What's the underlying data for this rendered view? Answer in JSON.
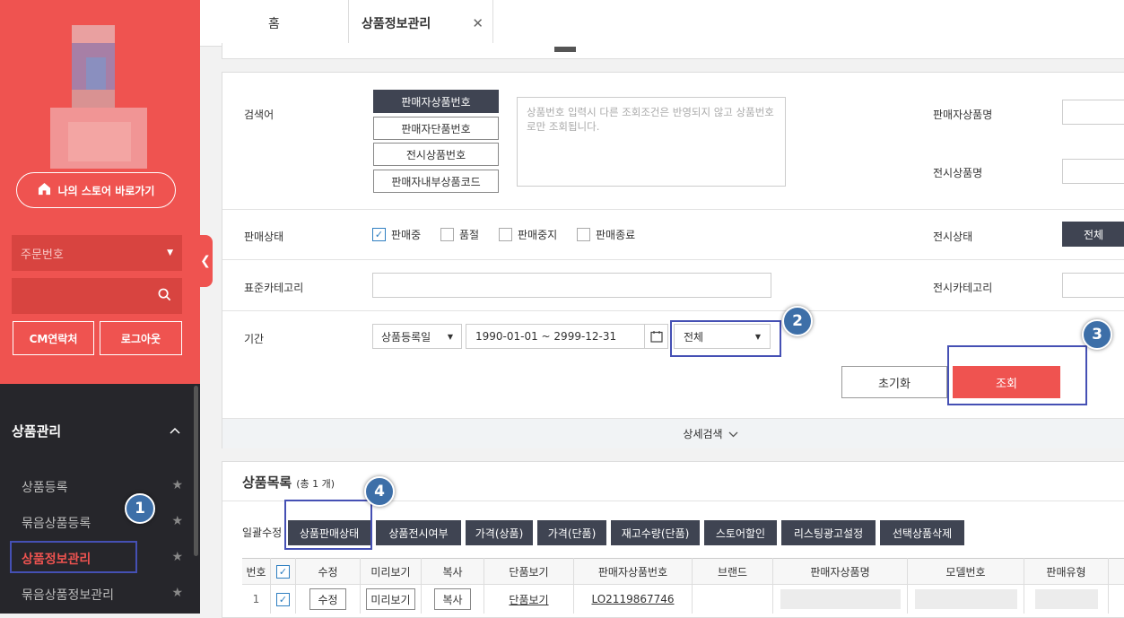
{
  "tabs": {
    "home": "홈",
    "active": "상품정보관리"
  },
  "sidebar": {
    "store_link": "나의 스토어 바로가기",
    "order_select": "주문번호",
    "contact_btn": "CM연락처",
    "logout_btn": "로그아웃",
    "menu_title": "상품관리",
    "menu_items": [
      "상품등록",
      "묶음상품등록",
      "상품정보관리",
      "묶음상품정보관리"
    ]
  },
  "search": {
    "keyword_label": "검색어",
    "keyword_types": [
      "판매자상품번호",
      "판매자단품번호",
      "전시상품번호",
      "판매자내부상품코드"
    ],
    "keyword_placeholder": "상품번호 입력시 다른 조회조건은 반영되지 않고 상품번호로만 조회됩니다.",
    "seller_name_label": "판매자상품명",
    "display_name_label": "전시상품명",
    "sale_status_label": "판매상태",
    "sale_statuses": [
      "판매중",
      "품절",
      "판매중지",
      "판매종료"
    ],
    "display_status_label": "전시상태",
    "display_status_value": "전체",
    "std_category_label": "표준카테고리",
    "display_category_label": "전시카테고리",
    "period_label": "기간",
    "period_type": "상품등록일",
    "date_range": "1990-01-01 ~ 2999-12-31",
    "period_filter": "전체",
    "reset_btn": "초기화",
    "search_btn": "조회",
    "detail_search": "상세검색"
  },
  "list": {
    "title": "상품목록",
    "count": "(총 1 개)",
    "bulk_label": "일괄수정",
    "bulk_buttons": [
      "상품판매상태",
      "상품전시여부",
      "가격(상품)",
      "가격(단품)",
      "재고수량(단품)",
      "스토어할인",
      "리스팅광고설정",
      "선택상품삭제"
    ],
    "headers": [
      "번호",
      "",
      "수정",
      "미리보기",
      "복사",
      "단품보기",
      "판매자상품번호",
      "브랜드",
      "판매자상품명",
      "모델번호",
      "판매유형"
    ],
    "row": {
      "num": "1",
      "edit": "수정",
      "preview": "미리보기",
      "copy": "복사",
      "item_view": "단품보기",
      "seller_no": "LO2119867746"
    }
  },
  "annotations": [
    "1",
    "2",
    "3",
    "4"
  ],
  "colors": {
    "sidebar": "#ef5350",
    "dark_btn": "#3f4452",
    "search_btn": "#ef5350",
    "highlight": "#4550b4",
    "badge": "#3d6fa8"
  }
}
